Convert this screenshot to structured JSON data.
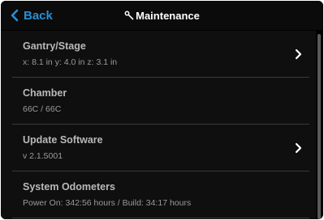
{
  "header": {
    "back_label": "Back",
    "title": "Maintenance"
  },
  "items": [
    {
      "title": "Gantry/Stage",
      "subtitle": "x:  8.1 in   y:  4.0 in   z:  3.1 in",
      "has_chevron": true
    },
    {
      "title": "Chamber",
      "subtitle": "66C / 66C",
      "has_chevron": false
    },
    {
      "title": "Update Software",
      "subtitle": "v 2.1.5001",
      "has_chevron": true
    },
    {
      "title": "System Odometers",
      "subtitle": "Power On: 342:56 hours / Build: 34:17 hours",
      "has_chevron": false
    }
  ],
  "colors": {
    "accent": "#2a8fd4",
    "background": "#000000",
    "list_background": "#0f0f0f",
    "divider": "#3a3a3a"
  },
  "icons": {
    "back": "chevron-left-icon",
    "title": "wrench-icon",
    "item_chevron": "chevron-right-icon"
  }
}
